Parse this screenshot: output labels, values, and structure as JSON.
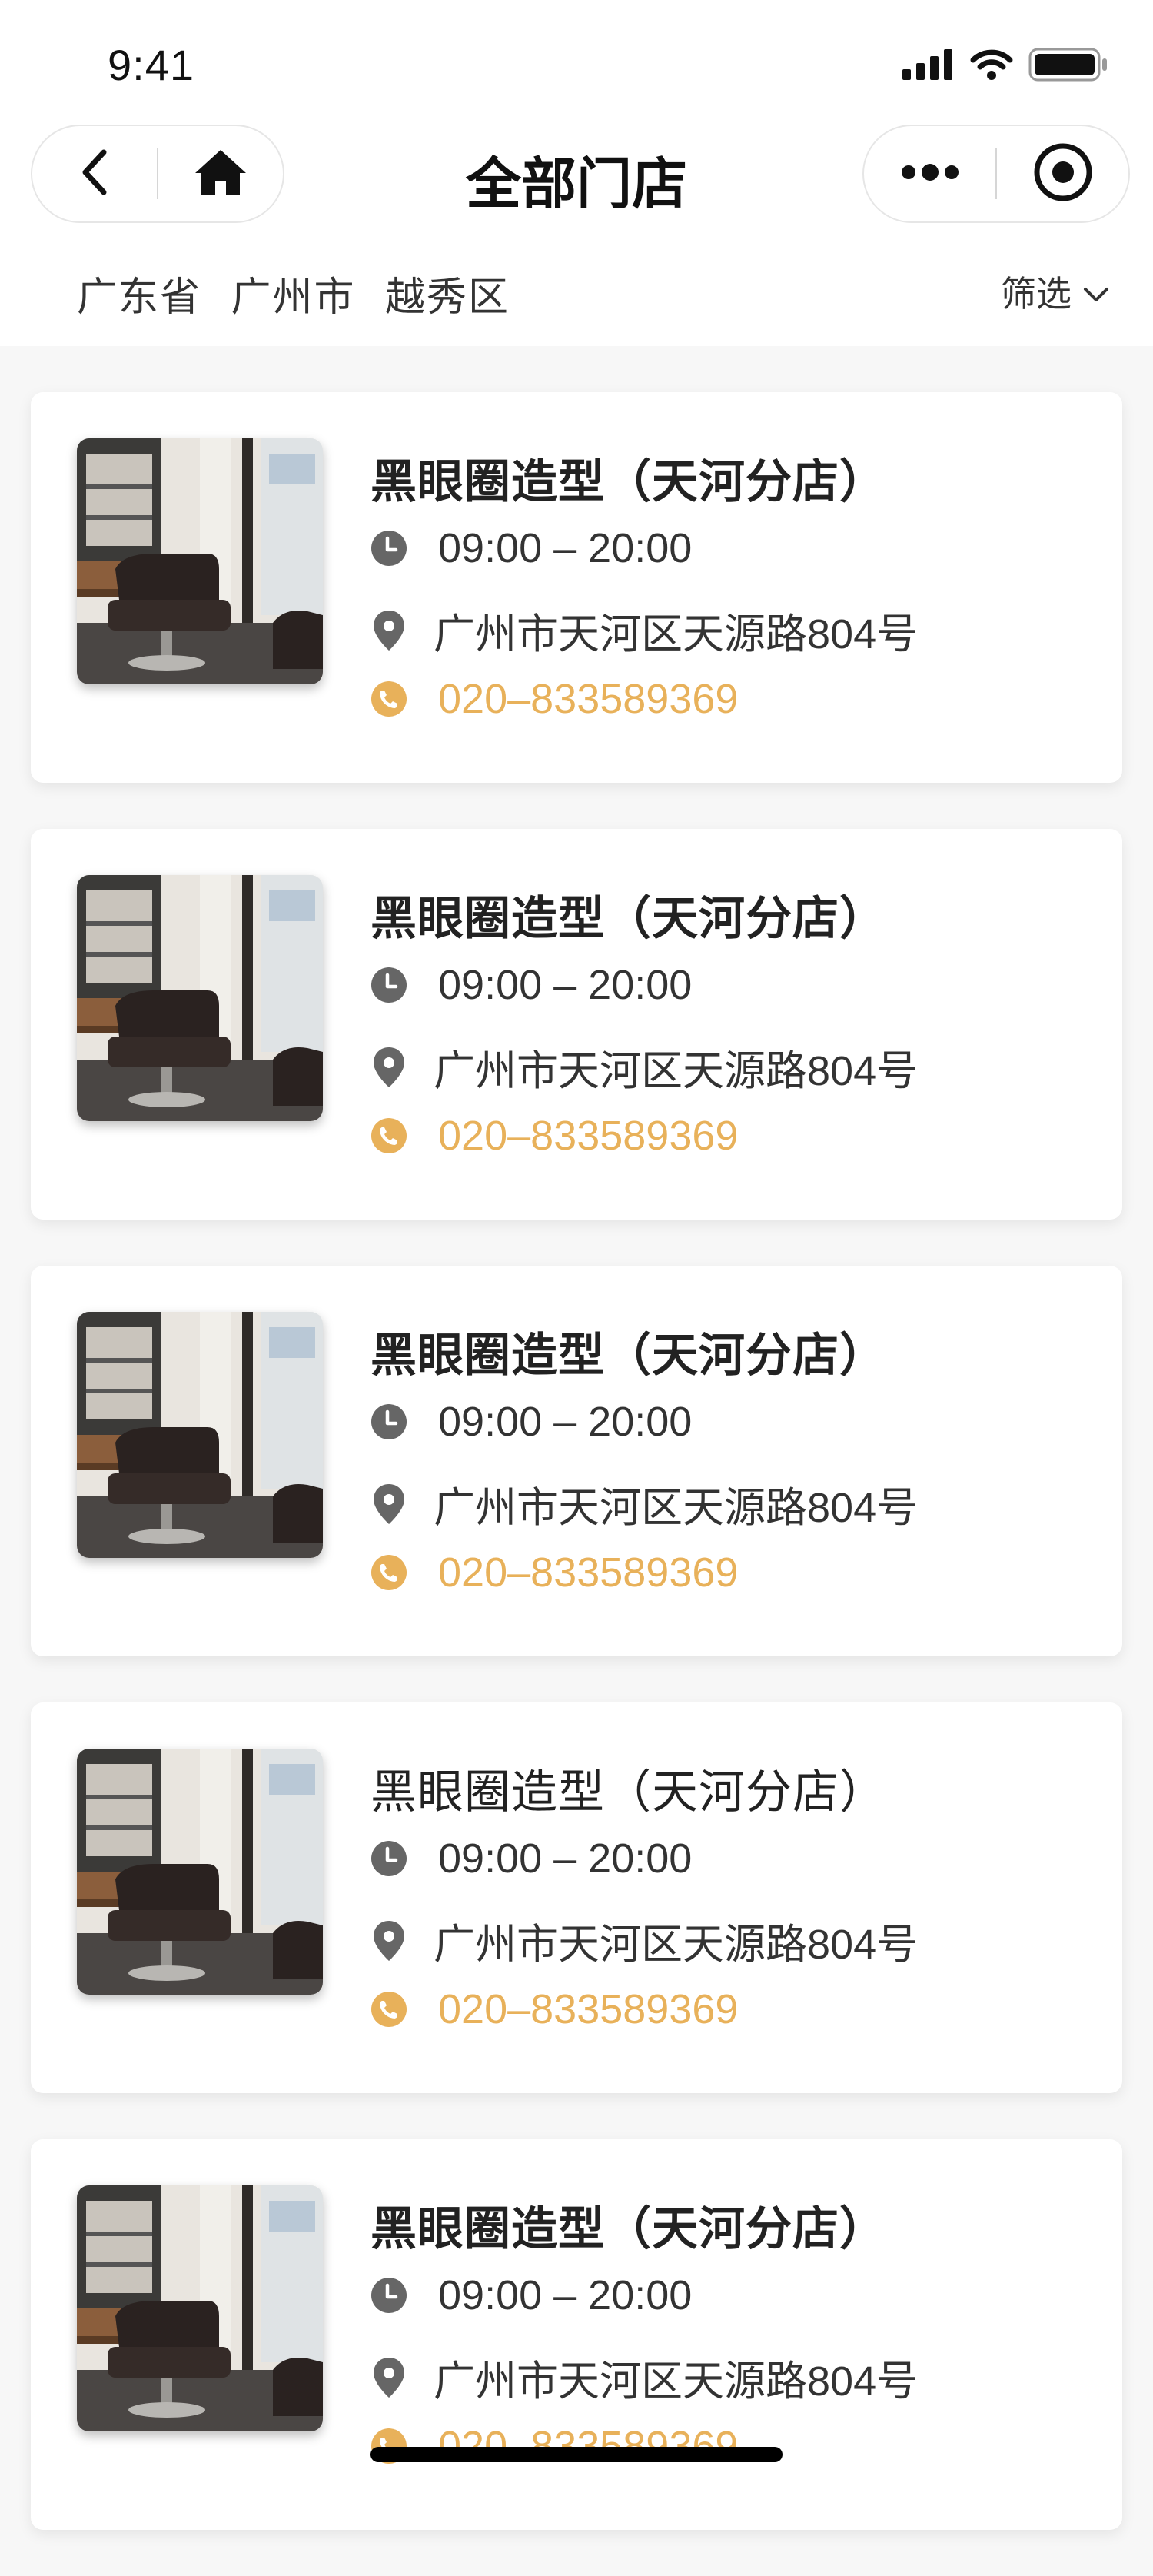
{
  "status_bar": {
    "time": "9:41"
  },
  "nav": {
    "title": "全部门店",
    "back_icon": "chevron-left-icon",
    "home_icon": "home-icon",
    "more_icon": "more-dots-icon",
    "target_icon": "target-icon"
  },
  "region": {
    "province": "广东省",
    "city": "广州市",
    "district": "越秀区",
    "filter_label": "筛选"
  },
  "colors": {
    "accent": "#E8B15A",
    "text": "#222222",
    "icon_gray": "#666666",
    "background": "#F7F7F7"
  },
  "stores": [
    {
      "name": "黑眼圈造型（天河分店）",
      "hours": "09:00 – 20:00",
      "address": "广州市天河区天源路804号",
      "phone": "020–833589369"
    },
    {
      "name": "黑眼圈造型（天河分店）",
      "hours": "09:00 – 20:00",
      "address": "广州市天河区天源路804号",
      "phone": "020–833589369"
    },
    {
      "name": "黑眼圈造型（天河分店）",
      "hours": "09:00 – 20:00",
      "address": "广州市天河区天源路804号",
      "phone": "020–833589369"
    },
    {
      "name": "黑眼圈造型（天河分店）",
      "hours": "09:00 – 20:00",
      "address": "广州市天河区天源路804号",
      "phone": "020–833589369"
    },
    {
      "name": "黑眼圈造型（天河分店）",
      "hours": "09:00 – 20:00",
      "address": "广州市天河区天源路804号",
      "phone": "020–833589369"
    }
  ]
}
